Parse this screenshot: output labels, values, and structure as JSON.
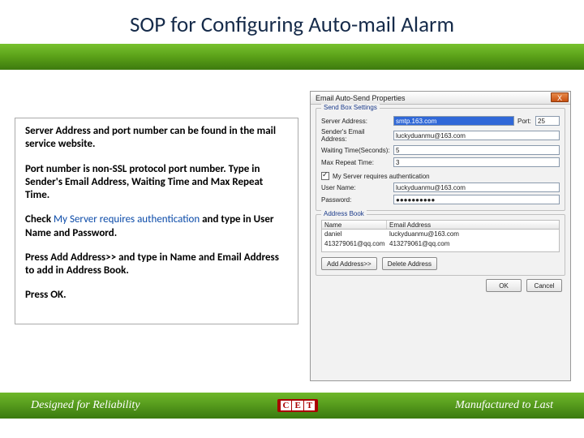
{
  "title": "SOP for Configuring Auto-mail Alarm",
  "instructions": {
    "p1a": "Server Address and port number can be found in the mail service website.",
    "p2a": "Port number is non-SSL protocol port number. Type in Sender's Email Address, Waiting Time and Max Repeat Time.",
    "p3a": "Check ",
    "p3b": "My Server requires authentication",
    "p3c": " and type in User Name and Password.",
    "p4a": "Press ",
    "p4b": "Add Address>>",
    "p4c": " and type in ",
    "p4d": "Name",
    "p4e": " and ",
    "p4f": "Email Address",
    "p4g": " to add in Address Book.",
    "p5a": "Press OK."
  },
  "dialog": {
    "title": "Email Auto-Send Properties",
    "close": "X",
    "group1": {
      "title": "Send Box Settings",
      "server_label": "Server Address:",
      "server_value": "smtp.163.com",
      "port_label": "Port:",
      "port_value": "25",
      "sender_label": "Sender's Email Address:",
      "sender_value": "luckyduanmu@163.com",
      "wait_label": "Waiting Time(Seconds):",
      "wait_value": "5",
      "repeat_label": "Max Repeat Time:",
      "repeat_value": "3",
      "auth_label": "My Server requires authentication",
      "user_label": "User Name:",
      "user_value": "luckyduanmu@163.com",
      "pass_label": "Password:",
      "pass_value": "●●●●●●●●●●"
    },
    "group2": {
      "title": "Address Book",
      "col_name": "Name",
      "col_email": "Email Address",
      "rows": [
        {
          "name": "daniel",
          "email": "luckyduanmu@163.com"
        },
        {
          "name": "413279061@qq.com",
          "email": "413279061@qq.com"
        }
      ],
      "add_btn": "Add Address>>",
      "del_btn": "Delete Address"
    },
    "ok": "OK",
    "cancel": "Cancel"
  },
  "footer": {
    "left": "Designed for Reliability",
    "logo1": "C",
    "logo2": "E",
    "logo3": "T",
    "right": "Manufactured to Last"
  }
}
